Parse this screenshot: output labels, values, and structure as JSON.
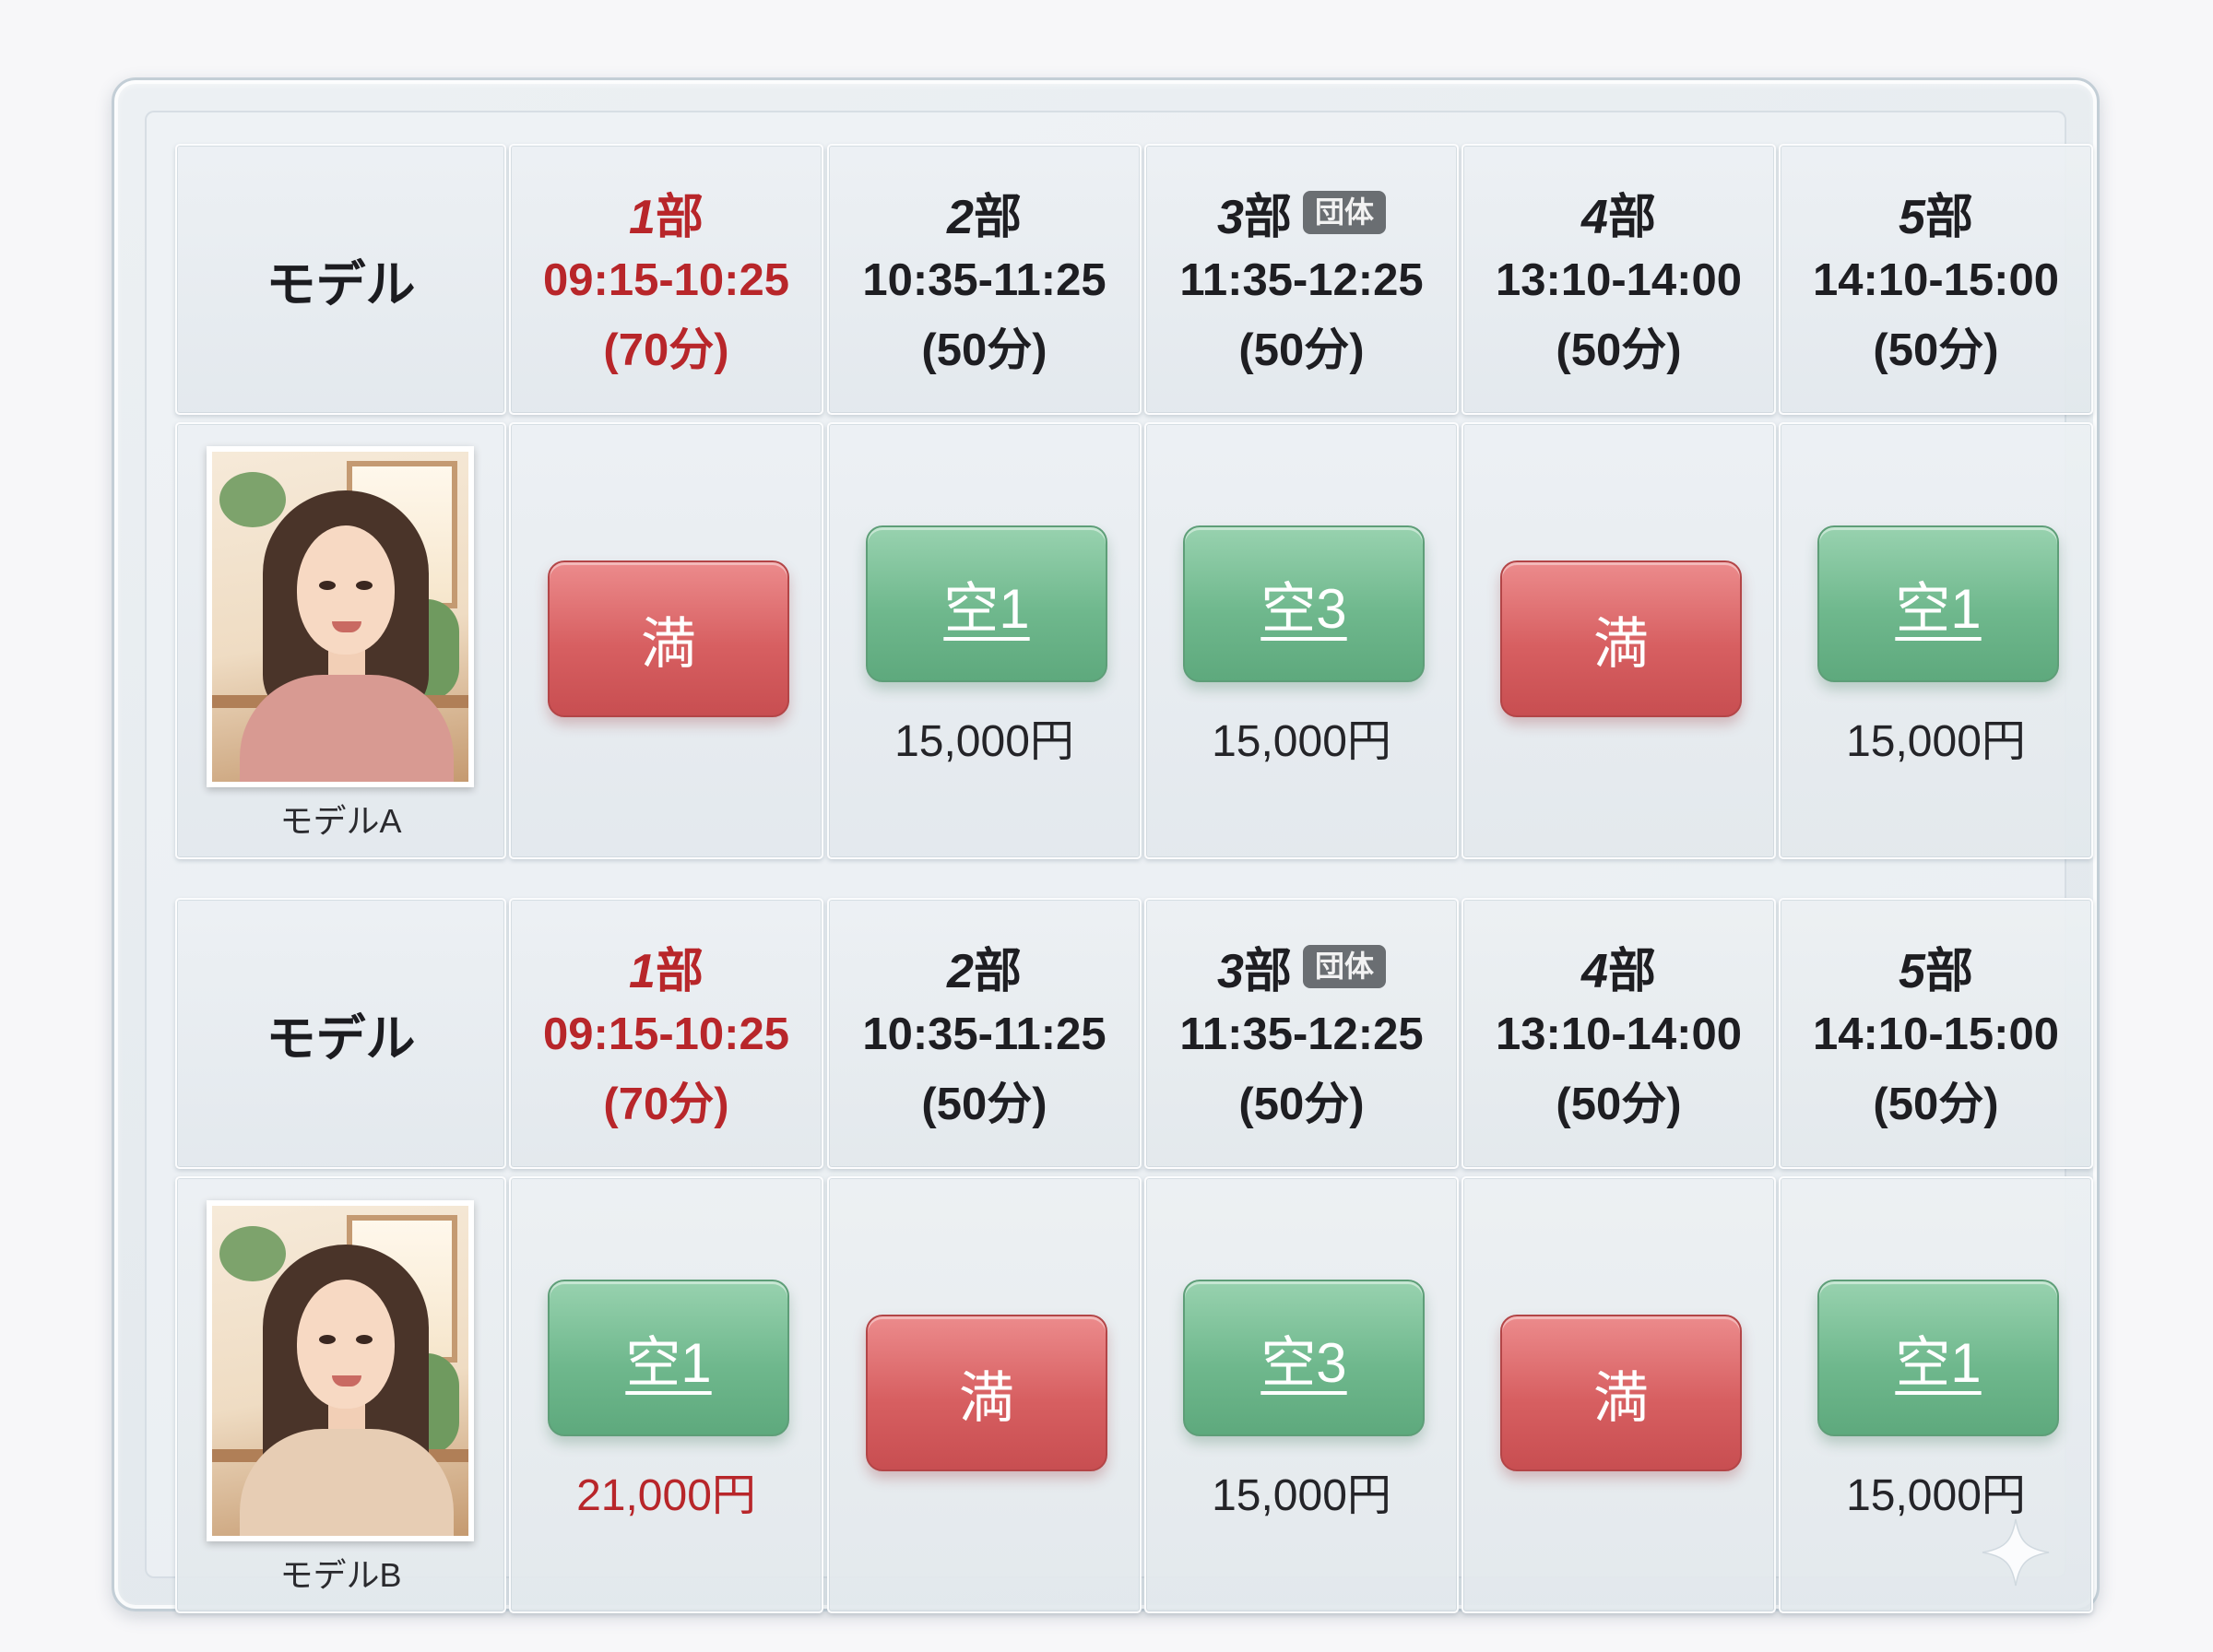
{
  "header": {
    "model_label": "モデル",
    "part_suffix": "部",
    "group_badge": "団体",
    "slots": [
      {
        "part": "1",
        "time": "09:15-10:25",
        "duration": "(70分)",
        "highlight": true,
        "group": false
      },
      {
        "part": "2",
        "time": "10:35-11:25",
        "duration": "(50分)",
        "highlight": false,
        "group": false
      },
      {
        "part": "3",
        "time": "11:35-12:25",
        "duration": "(50分)",
        "highlight": false,
        "group": true
      },
      {
        "part": "4",
        "time": "13:10-14:00",
        "duration": "(50分)",
        "highlight": false,
        "group": false
      },
      {
        "part": "5",
        "time": "14:10-15:00",
        "duration": "(50分)",
        "highlight": false,
        "group": false
      }
    ]
  },
  "models": [
    {
      "name": "モデルA",
      "slots": [
        {
          "status": "full",
          "label": "満",
          "price": ""
        },
        {
          "status": "open",
          "label": "空1",
          "price": "15,000円"
        },
        {
          "status": "open",
          "label": "空3",
          "price": "15,000円"
        },
        {
          "status": "full",
          "label": "満",
          "price": ""
        },
        {
          "status": "open",
          "label": "空1",
          "price": "15,000円"
        }
      ]
    },
    {
      "name": "モデルB",
      "slots": [
        {
          "status": "open",
          "label": "空1",
          "price": "21,000円"
        },
        {
          "status": "full",
          "label": "満",
          "price": ""
        },
        {
          "status": "open",
          "label": "空3",
          "price": "15,000円"
        },
        {
          "status": "full",
          "label": "満",
          "price": ""
        },
        {
          "status": "open",
          "label": "空1",
          "price": "15,000円"
        }
      ]
    }
  ],
  "colors": {
    "open_button": "#6fb88d",
    "full_button": "#d75f61",
    "highlight_text": "#b8262a",
    "badge_bg": "#6a6e72"
  },
  "icons": {
    "corner": "sparkle-icon"
  }
}
